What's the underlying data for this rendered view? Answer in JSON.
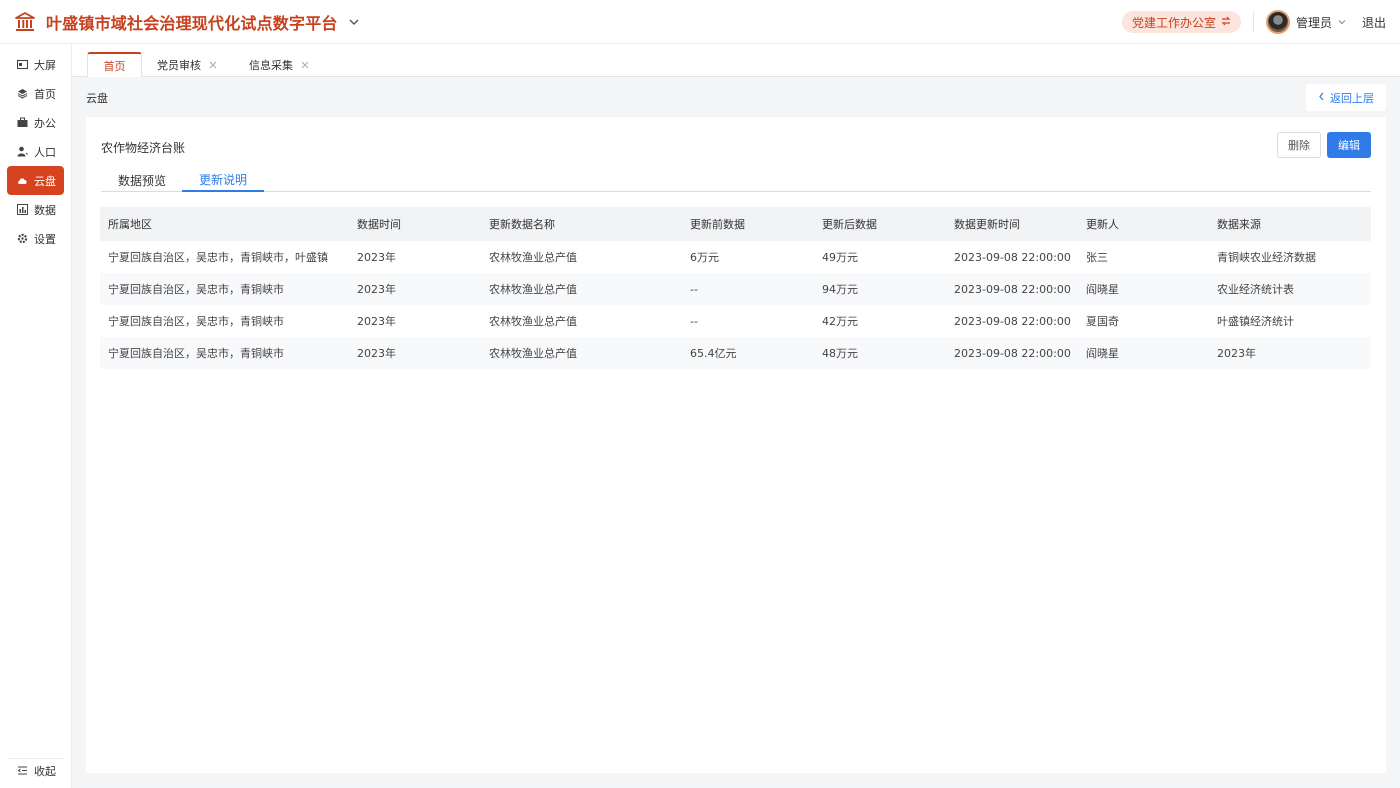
{
  "header": {
    "app_title": "叶盛镇市域社会治理现代化试点数字平台",
    "office_label": "党建工作办公室",
    "user_name": "管理员",
    "logout_label": "退出",
    "accent_color": "#c8401e"
  },
  "sidebar": {
    "items": [
      {
        "label": "大屏",
        "icon": "monitor-icon"
      },
      {
        "label": "首页",
        "icon": "layers-icon"
      },
      {
        "label": "办公",
        "icon": "briefcase-icon"
      },
      {
        "label": "人口",
        "icon": "person-icon"
      },
      {
        "label": "云盘",
        "icon": "cloud-icon",
        "active": true
      },
      {
        "label": "数据",
        "icon": "chart-icon"
      },
      {
        "label": "设置",
        "icon": "gear-icon"
      }
    ],
    "collapse_label": "收起"
  },
  "tabs": [
    {
      "label": "首页",
      "active": true
    },
    {
      "label": "党员审核"
    },
    {
      "label": "信息采集"
    }
  ],
  "breadcrumb": "云盘",
  "back_label": "返回上层",
  "card": {
    "title": "农作物经济台账",
    "delete_label": "删除",
    "edit_label": "编辑",
    "subtabs": [
      "数据预览",
      "更新说明"
    ],
    "active_subtab": 1
  },
  "table": {
    "columns": [
      "所属地区",
      "数据时间",
      "更新数据名称",
      "更新前数据",
      "更新后数据",
      "数据更新时间",
      "更新人",
      "数据来源"
    ],
    "rows": [
      [
        "宁夏回族自治区，吴忠市，青铜峡市，叶盛镇",
        "2023年",
        "农林牧渔业总产值",
        "6万元",
        "49万元",
        "2023-09-08 22:00:00",
        "张三",
        "青铜峡农业经济数据"
      ],
      [
        "宁夏回族自治区，吴忠市，青铜峡市",
        "2023年",
        "农林牧渔业总产值",
        "--",
        "94万元",
        "2023-09-08 22:00:00",
        "阎晓星",
        "农业经济统计表"
      ],
      [
        "宁夏回族自治区，吴忠市，青铜峡市",
        "2023年",
        "农林牧渔业总产值",
        "--",
        "42万元",
        "2023-09-08 22:00:00",
        "夏国奇",
        "叶盛镇经济统计"
      ],
      [
        "宁夏回族自治区，吴忠市，青铜峡市",
        "2023年",
        "农林牧渔业总产值",
        "65.4亿元",
        "48万元",
        "2023-09-08 22:00:00",
        "阎晓星",
        "2023年"
      ]
    ]
  }
}
